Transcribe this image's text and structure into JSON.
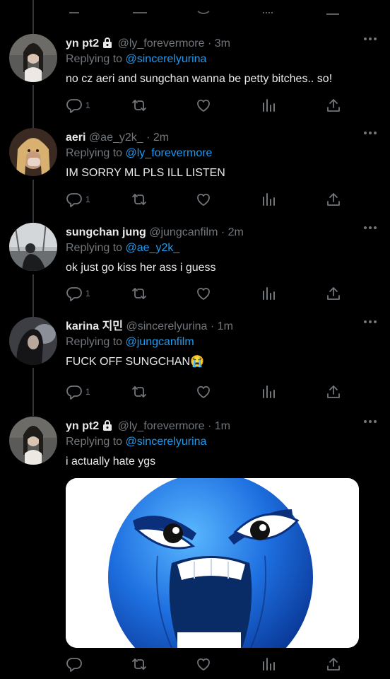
{
  "tweets": [
    {
      "name": "yn pt2",
      "locked": true,
      "handle": "@ly_forevermore",
      "time": "· 3m",
      "replying_prefix": "Replying to ",
      "replying_to": "@sincerelyurina",
      "text": "no cz aeri and sungchan wanna be petty bitches.. so!",
      "reply_count": "1"
    },
    {
      "name": "aeri",
      "locked": false,
      "handle": "@ae_y2k_",
      "time": "· 2m",
      "replying_prefix": "Replying to ",
      "replying_to": "@ly_forevermore",
      "text": "IM SORRY ML PLS ILL LISTEN",
      "reply_count": "1"
    },
    {
      "name": "sungchan jung",
      "locked": false,
      "handle": "@jungcanfilm",
      "time": "· 2m",
      "replying_prefix": "Replying to ",
      "replying_to": "@ae_y2k_",
      "text": "ok just go kiss her ass i guess",
      "reply_count": "1"
    },
    {
      "name": "karina 지민",
      "locked": false,
      "handle": "@sincerelyurina",
      "time": "· 1m",
      "replying_prefix": "Replying to ",
      "replying_to": "@jungcanfilm",
      "text": "FUCK OFF SUNGCHAN😭",
      "reply_count": "1"
    },
    {
      "name": "yn pt2",
      "locked": true,
      "handle": "@ly_forevermore",
      "time": "· 1m",
      "replying_prefix": "Replying to ",
      "replying_to": "@sincerelyurina",
      "text": "i actually hate ygs",
      "reply_count": ""
    }
  ],
  "colors": {
    "background": "#000000",
    "text": "#e7e9ea",
    "muted": "#71767b",
    "link": "#1d9bf0"
  },
  "icons": [
    "reply-icon",
    "retweet-icon",
    "like-icon",
    "analytics-icon",
    "share-icon",
    "more-icon",
    "lock-icon"
  ]
}
